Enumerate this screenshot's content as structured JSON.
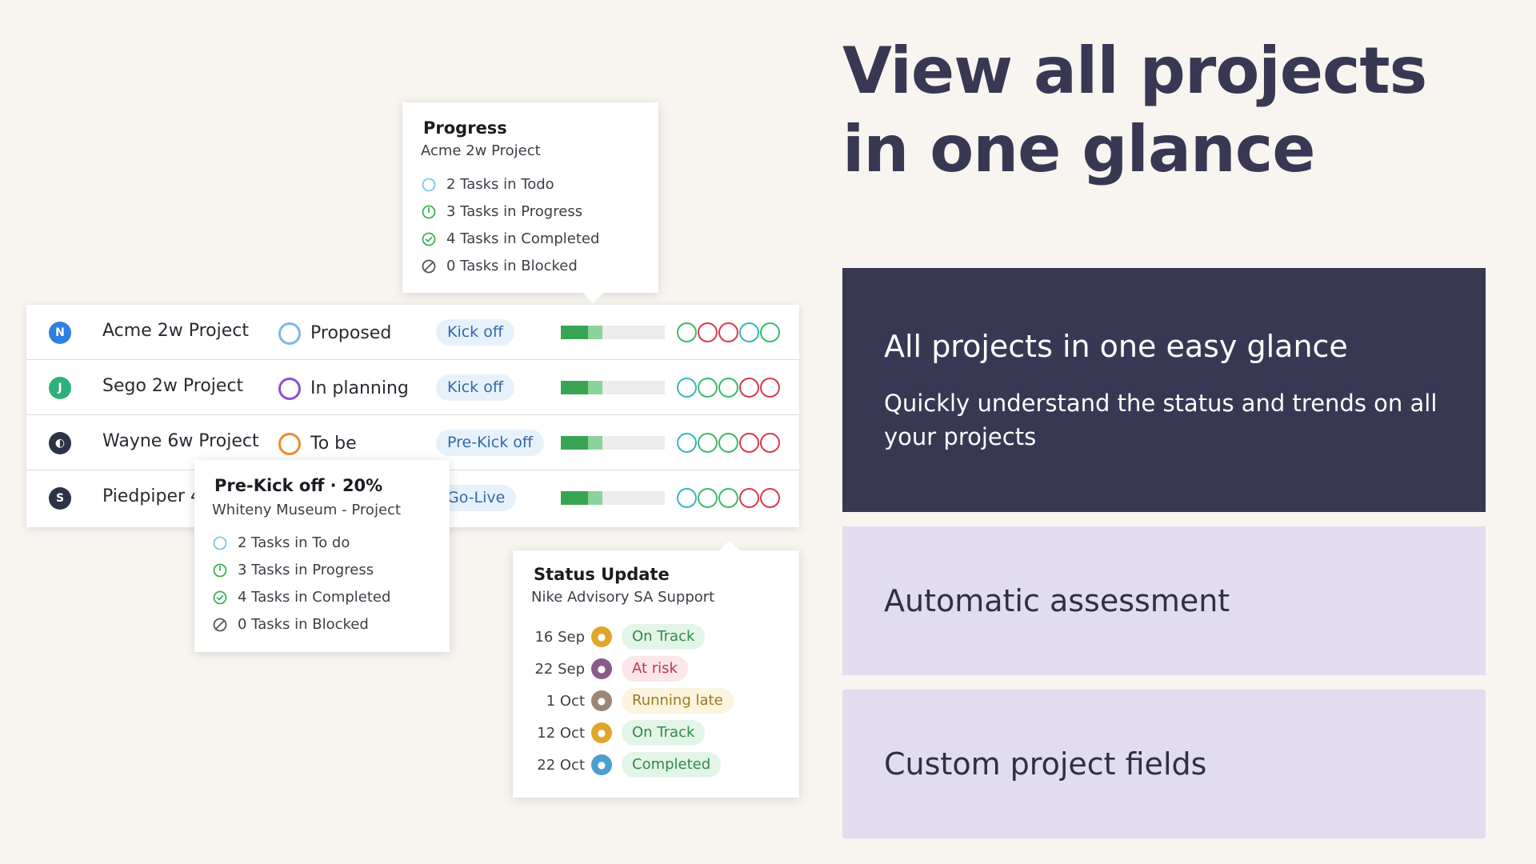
{
  "headline": "View all projects in one glance",
  "features": [
    {
      "title": "All projects in one easy glance",
      "description": "Quickly understand the status and trends on all your projects"
    },
    {
      "title": "Automatic assessment"
    },
    {
      "title": "Custom project fields"
    }
  ],
  "projects": [
    {
      "name": "Acme 2w Project",
      "status": "Proposed",
      "phase": "Kick off",
      "progress": 0.4,
      "logo_color": "#2f7fe0",
      "status_color": "#7db7e6",
      "health": [
        "#3dbb63",
        "#d9394c",
        "#d9394c",
        "#35b6c6",
        "#3dbb63"
      ]
    },
    {
      "name": "Sego 2w Project",
      "status": "In planning",
      "phase": "Kick off",
      "progress": 0.4,
      "logo_color": "#2fb07a",
      "status_color": "#8a4fd8",
      "health": [
        "#35b6c6",
        "#3dbb63",
        "#3dbb63",
        "#d9394c",
        "#d9394c"
      ]
    },
    {
      "name": "Wayne 6w Project",
      "status": "To be",
      "phase": "Pre-Kick off",
      "progress": 0.4,
      "logo_color": "#2b3344",
      "status_color": "#f08a2e",
      "health": [
        "#35b6c6",
        "#3dbb63",
        "#3dbb63",
        "#d9394c",
        "#d9394c"
      ]
    },
    {
      "name": "Piedpiper 4",
      "status": "",
      "phase": "Go-Live",
      "progress": 0.4,
      "logo_color": "#2b3344",
      "status_color": "#7db7e6",
      "health": [
        "#35b6c6",
        "#3dbb63",
        "#3dbb63",
        "#d9394c",
        "#d9394c"
      ]
    }
  ],
  "progress_popover": {
    "title": "Progress",
    "subtitle": "Acme 2w Project",
    "tasks": [
      {
        "label": "2 Tasks in Todo",
        "icon": "todo-icon"
      },
      {
        "label": "3 Tasks in Progress",
        "icon": "in-progress-icon"
      },
      {
        "label": "4 Tasks in Completed",
        "icon": "completed-icon"
      },
      {
        "label": "0 Tasks in Blocked",
        "icon": "blocked-icon"
      }
    ]
  },
  "prekick_popover": {
    "title": "Pre-Kick off · 20%",
    "subtitle": "Whiteny Museum - Project",
    "tasks": [
      {
        "label": "2 Tasks in To do",
        "icon": "todo-icon"
      },
      {
        "label": "3 Tasks in Progress",
        "icon": "in-progress-icon"
      },
      {
        "label": "4 Tasks in Completed",
        "icon": "completed-icon"
      },
      {
        "label": "0 Tasks in Blocked",
        "icon": "blocked-icon"
      }
    ]
  },
  "status_popover": {
    "title": "Status Update",
    "subtitle": "Nike Advisory SA Support",
    "updates": [
      {
        "date": "16 Sep",
        "status": "On Track",
        "bg": "#e3f5e8",
        "fg": "#2f8a47",
        "avatar_color": "#e0a52c"
      },
      {
        "date": "22 Sep",
        "status": "At risk",
        "bg": "#fbe6ea",
        "fg": "#c2334b",
        "avatar_color": "#8a5a8a"
      },
      {
        "date": "1 Oct",
        "status": "Running late",
        "bg": "#fbf4de",
        "fg": "#9a7a1c",
        "avatar_color": "#9b8575"
      },
      {
        "date": "12 Oct",
        "status": "On Track",
        "bg": "#e3f5e8",
        "fg": "#2f8a47",
        "avatar_color": "#e0a52c"
      },
      {
        "date": "22 Oct",
        "status": "Completed",
        "bg": "#e3f5e8",
        "fg": "#2f8a47",
        "avatar_color": "#4a9fd0"
      }
    ]
  }
}
